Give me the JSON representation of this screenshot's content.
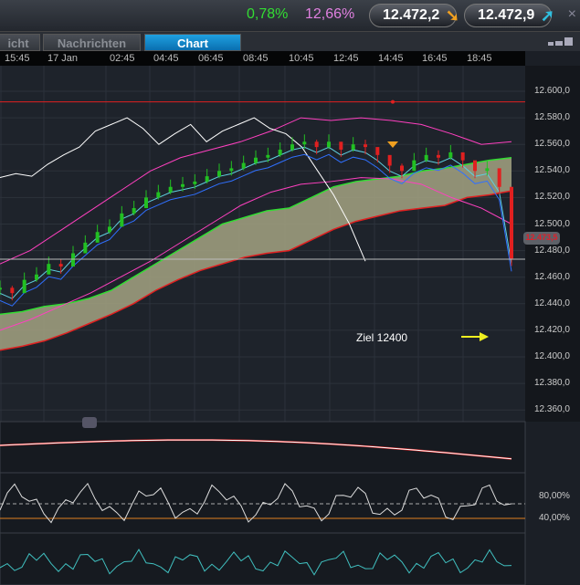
{
  "header": {
    "change_pct": "0,78%",
    "volatility_pct": "12,66%",
    "bid": "12.472,2",
    "ask": "12.472,9",
    "close_label": "×"
  },
  "tabs": [
    {
      "label": "icht"
    },
    {
      "label": "Nachrichten"
    },
    {
      "label": "Chart"
    }
  ],
  "time_axis": [
    "15:45",
    "17 Jan",
    "02:45",
    "04:45",
    "06:45",
    "08:45",
    "10:45",
    "12:45",
    "14:45",
    "16:45",
    "18:45"
  ],
  "price_axis": [
    "12.600,0",
    "12.580,0",
    "12.560,0",
    "12.540,0",
    "12.520,0",
    "12.500,0",
    "12.480,0",
    "12.460,0",
    "12.440,0",
    "12.420,0",
    "12.400,0",
    "12.380,0",
    "12.360,0"
  ],
  "current_price": "12.473,5",
  "annotation": {
    "text": "Ziel  12400"
  },
  "oscillator_levels": [
    "80,00%",
    "40,00%"
  ],
  "colors": {
    "up": "#22c022",
    "down": "#e02020",
    "green": "#33dd33",
    "magenta": "#ff40c0",
    "bid_arrow": "#f0a020",
    "ask_arrow": "#30c0e0"
  },
  "chart_data": {
    "type": "line",
    "price_range": [
      12350,
      12610
    ],
    "close": [
      12452,
      12448,
      12458,
      12462,
      12470,
      12468,
      12478,
      12486,
      12494,
      12498,
      12508,
      12512,
      12520,
      12524,
      12528,
      12530,
      12532,
      12536,
      12540,
      12542,
      12546,
      12550,
      12552,
      12556,
      12560,
      12562,
      12558,
      12562,
      12556,
      12560,
      12558,
      12552,
      12544,
      12540,
      12548,
      12552,
      12550,
      12554,
      12548,
      12540,
      12542,
      12528,
      12474
    ],
    "cloud_upper": [
      12432,
      12434,
      12438,
      12440,
      12444,
      12450,
      12460,
      12470,
      12480,
      12490,
      12500,
      12505,
      12510,
      12512,
      12520,
      12528,
      12532,
      12534,
      12536,
      12540,
      12542,
      12545,
      12548,
      12550
    ],
    "cloud_lower": [
      12405,
      12408,
      12412,
      12418,
      12425,
      12432,
      12440,
      12450,
      12458,
      12465,
      12470,
      12475,
      12478,
      12480,
      12488,
      12496,
      12502,
      12506,
      12510,
      12512,
      12514,
      12520,
      12522,
      12525
    ],
    "lagging": [
      12535,
      12538,
      12536,
      12545,
      12552,
      12558,
      12570,
      12575,
      12580,
      12572,
      12560,
      12568,
      12575,
      12562,
      12570,
      12575,
      12580,
      12572,
      12568,
      12558,
      12540,
      12522,
      12500,
      12472
    ],
    "band_upper": [
      12470,
      12480,
      12495,
      12510,
      12525,
      12540,
      12550,
      12556,
      12562,
      12570,
      12580,
      12578,
      12580,
      12578,
      12575,
      12568,
      12560,
      12562
    ],
    "band_lower": [
      12420,
      12428,
      12438,
      12448,
      12460,
      12472,
      12486,
      12500,
      12514,
      12524,
      12530,
      12532,
      12535,
      12534,
      12530,
      12520,
      12512,
      12500
    ]
  }
}
